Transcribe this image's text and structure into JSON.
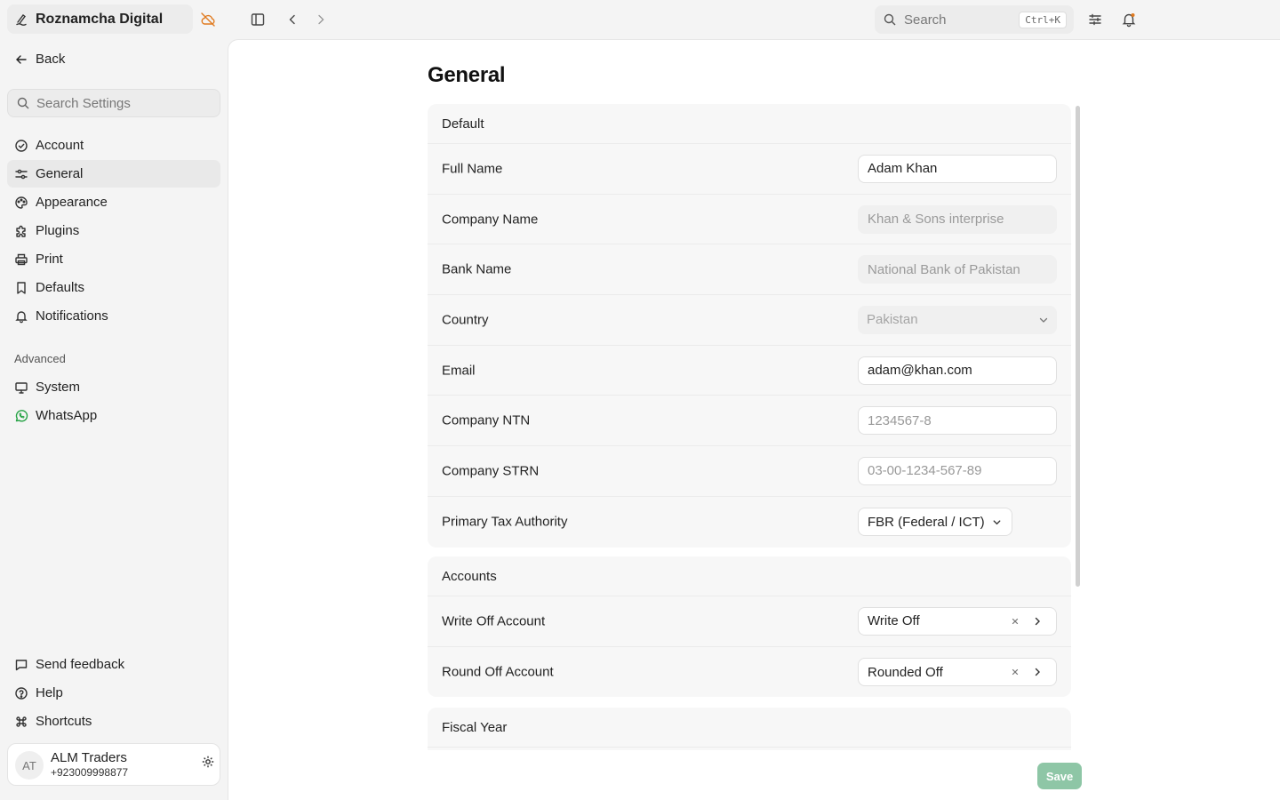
{
  "app": {
    "name": "Roznamcha Digital"
  },
  "topbar": {
    "search_placeholder": "Search",
    "search_shortcut": "Ctrl+K"
  },
  "sidebar": {
    "back_label": "Back",
    "search_placeholder": "Search Settings",
    "items": [
      {
        "label": "Account",
        "icon": "account-check-icon"
      },
      {
        "label": "General",
        "icon": "sliders-icon",
        "active": true
      },
      {
        "label": "Appearance",
        "icon": "palette-icon"
      },
      {
        "label": "Plugins",
        "icon": "puzzle-icon"
      },
      {
        "label": "Print",
        "icon": "printer-icon"
      },
      {
        "label": "Defaults",
        "icon": "bookmark-icon"
      },
      {
        "label": "Notifications",
        "icon": "bell-icon"
      }
    ],
    "advanced_label": "Advanced",
    "advanced_items": [
      {
        "label": "System",
        "icon": "monitor-icon"
      },
      {
        "label": "WhatsApp",
        "icon": "whatsapp-icon"
      }
    ],
    "footer_items": [
      {
        "label": "Send feedback",
        "icon": "message-icon"
      },
      {
        "label": "Help",
        "icon": "help-icon"
      },
      {
        "label": "Shortcuts",
        "icon": "command-icon"
      }
    ],
    "user": {
      "initials": "AT",
      "name": "ALM Traders",
      "phone": "+923009998877"
    }
  },
  "main": {
    "title": "General",
    "sections": {
      "default": {
        "header": "Default",
        "full_name": {
          "label": "Full Name",
          "value": "Adam Khan"
        },
        "company_name": {
          "label": "Company Name",
          "placeholder": "Khan & Sons interprise"
        },
        "bank_name": {
          "label": "Bank Name",
          "placeholder": "National Bank of Pakistan"
        },
        "country": {
          "label": "Country",
          "value": "Pakistan"
        },
        "email": {
          "label": "Email",
          "value": "adam@khan.com"
        },
        "company_ntn": {
          "label": "Company NTN",
          "placeholder": "1234567-8"
        },
        "company_strn": {
          "label": "Company STRN",
          "placeholder": "03-00-1234-567-89"
        },
        "tax_authority": {
          "label": "Primary Tax Authority",
          "value": "FBR (Federal / ICT)"
        }
      },
      "accounts": {
        "header": "Accounts",
        "write_off": {
          "label": "Write Off Account",
          "value": "Write Off"
        },
        "round_off": {
          "label": "Round Off Account",
          "value": "Rounded Off"
        }
      },
      "fiscal_year": {
        "header": "Fiscal Year"
      }
    },
    "save_label": "Save"
  },
  "colors": {
    "accent": "#8ec6a6",
    "offline": "#e07a1f",
    "whatsapp": "#25a244"
  }
}
